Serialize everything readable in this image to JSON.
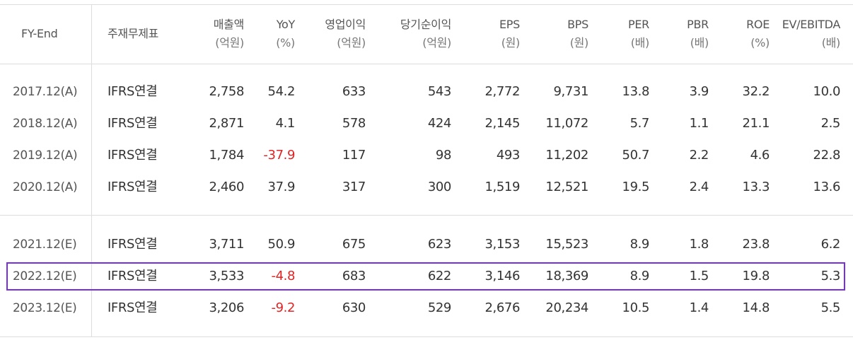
{
  "table": {
    "headers": [
      {
        "label": "FY-End",
        "unit": ""
      },
      {
        "label": "주재무제표",
        "unit": ""
      },
      {
        "label": "매출액",
        "unit": "(억원)"
      },
      {
        "label": "YoY",
        "unit": "(%)"
      },
      {
        "label": "영업이익",
        "unit": "(억원)"
      },
      {
        "label": "당기순이익",
        "unit": "(억원)"
      },
      {
        "label": "EPS",
        "unit": "(원)"
      },
      {
        "label": "BPS",
        "unit": "(원)"
      },
      {
        "label": "PER",
        "unit": "(배)"
      },
      {
        "label": "PBR",
        "unit": "(배)"
      },
      {
        "label": "ROE",
        "unit": "(%)"
      },
      {
        "label": "EV/EBITDA",
        "unit": "(배)"
      }
    ],
    "rows": [
      [
        "2017.12(A)",
        "IFRS연결",
        "2,758",
        "54.2",
        "633",
        "543",
        "2,772",
        "9,731",
        "13.8",
        "3.9",
        "32.2",
        "10.0"
      ],
      [
        "2018.12(A)",
        "IFRS연결",
        "2,871",
        "4.1",
        "578",
        "424",
        "2,145",
        "11,072",
        "5.7",
        "1.1",
        "21.1",
        "2.5"
      ],
      [
        "2019.12(A)",
        "IFRS연결",
        "1,784",
        "-37.9",
        "117",
        "98",
        "493",
        "11,202",
        "50.7",
        "2.2",
        "4.6",
        "22.8"
      ],
      [
        "2020.12(A)",
        "IFRS연결",
        "2,460",
        "37.9",
        "317",
        "300",
        "1,519",
        "12,521",
        "19.5",
        "2.4",
        "13.3",
        "13.6"
      ],
      [
        "2021.12(E)",
        "IFRS연결",
        "3,711",
        "50.9",
        "675",
        "623",
        "3,153",
        "15,523",
        "8.9",
        "1.8",
        "23.8",
        "6.2"
      ],
      [
        "2022.12(E)",
        "IFRS연결",
        "3,533",
        "-4.8",
        "683",
        "622",
        "3,146",
        "18,369",
        "8.9",
        "1.5",
        "19.8",
        "5.3"
      ],
      [
        "2023.12(E)",
        "IFRS연결",
        "3,206",
        "-9.2",
        "630",
        "529",
        "2,676",
        "20,234",
        "10.5",
        "1.4",
        "14.8",
        "5.5"
      ]
    ],
    "highlight_color": "#7b2ee0",
    "negative_color": "#e02424"
  }
}
